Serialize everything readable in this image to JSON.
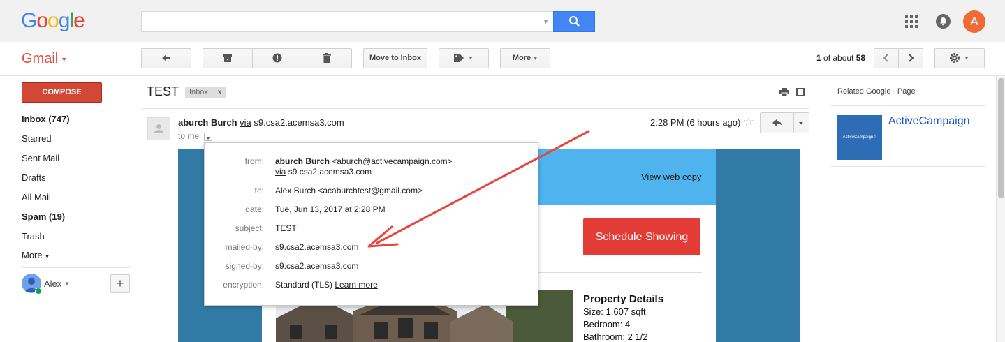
{
  "header": {
    "logo": "Google",
    "logo_colors": [
      "#4285f4",
      "#ea4335",
      "#fbbc05",
      "#4285f4",
      "#34a853",
      "#ea4335"
    ],
    "search_value": "",
    "avatar_letter": "A"
  },
  "toolbar": {
    "app_label": "Gmail",
    "move_to_inbox": "Move to Inbox",
    "more": "More",
    "pager_range": "1",
    "pager_mid": " of about ",
    "pager_total": "58"
  },
  "nav": {
    "compose": "COMPOSE",
    "items": [
      {
        "label": "Inbox (747)",
        "bold": true
      },
      {
        "label": "Starred",
        "bold": false
      },
      {
        "label": "Sent Mail",
        "bold": false
      },
      {
        "label": "Drafts",
        "bold": false
      },
      {
        "label": "All Mail",
        "bold": false
      },
      {
        "label": "Spam (19)",
        "bold": true
      },
      {
        "label": "Trash",
        "bold": false
      },
      {
        "label": "More",
        "bold": false
      }
    ],
    "user_name": "Alex"
  },
  "thread": {
    "subject": "TEST",
    "label_chip": "Inbox",
    "label_chip_close": "x"
  },
  "message": {
    "sender_name": "aburch Burch",
    "via": "via",
    "via_domain": "s9.csa2.acemsa3.com",
    "to_me": "to me",
    "time": "2:28 PM (6 hours ago)",
    "star": "☆"
  },
  "details": {
    "from_label": "from:",
    "from_name": "aburch Burch",
    "from_email": "<aburch@activecampaign.com>",
    "from_via": "via",
    "from_via_domain": "s9.csa2.acemsa3.com",
    "to_label": "to:",
    "to_value": "Alex Burch <acaburchtest@gmail.com>",
    "date_label": "date:",
    "date_value": "Tue, Jun 13, 2017 at 2:28 PM",
    "subject_label": "subject:",
    "subject_value": "TEST",
    "mailed_by_label": "mailed-by:",
    "mailed_by_value": "s9.csa2.acemsa3.com",
    "signed_by_label": "signed-by:",
    "signed_by_value": "s9.csa2.acemsa3.com",
    "encryption_label": "encryption:",
    "encryption_value": "Standard (TLS) ",
    "encryption_link": "Learn more"
  },
  "email_body": {
    "view_web_copy": "View web copy",
    "schedule_button": "Schedule Showing",
    "property_title": "Property Details",
    "property_lines": [
      "Size: 1,607 sqft",
      "Bedroom: 4",
      "Bathroom: 2 1/2"
    ],
    "colors": {
      "outer": "#307aa5",
      "band": "#4fb3ee",
      "button": "#e33b35"
    }
  },
  "related": {
    "title": "Related Google+ Page",
    "page_name": "ActiveCampaign",
    "logo_text": "ActiveCampaign >"
  },
  "annotation": {
    "arrow_color": "#e8453c"
  }
}
